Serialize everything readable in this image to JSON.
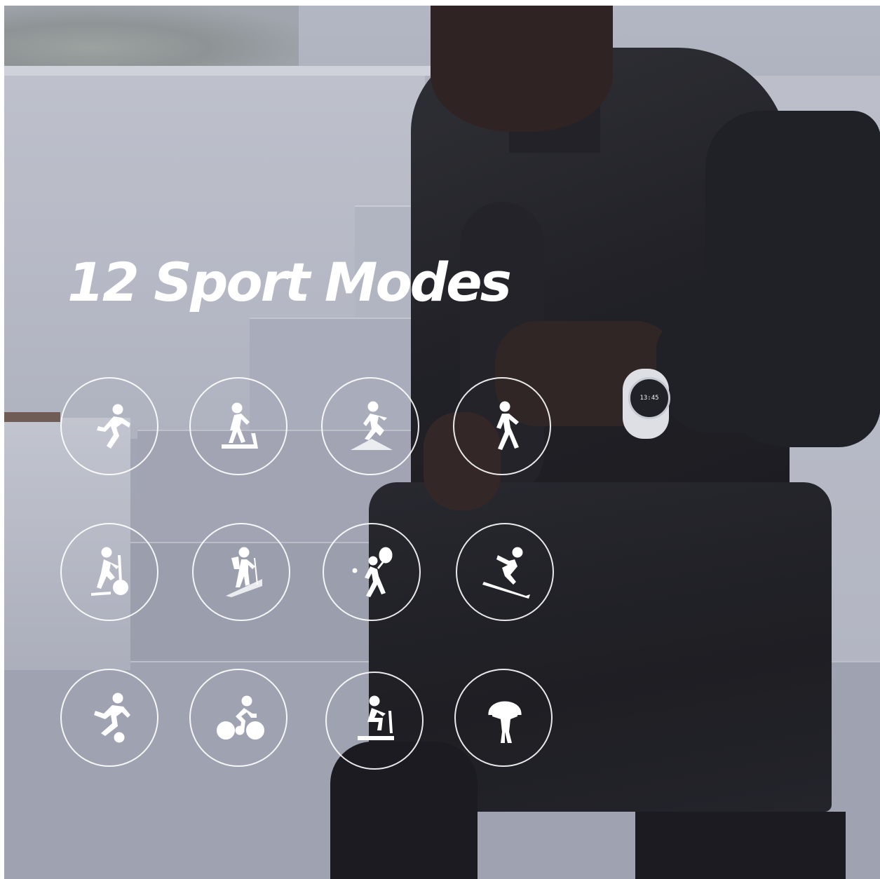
{
  "headline": "12 Sport Modes",
  "watch": {
    "time": "13:45"
  },
  "sport_modes": [
    {
      "icon": "outdoor-running-icon"
    },
    {
      "icon": "treadmill-icon"
    },
    {
      "icon": "trail-running-icon"
    },
    {
      "icon": "walking-icon"
    },
    {
      "icon": "elliptical-trainer-icon"
    },
    {
      "icon": "climbing-icon"
    },
    {
      "icon": "tennis-icon"
    },
    {
      "icon": "skiing-icon"
    },
    {
      "icon": "soccer-icon"
    },
    {
      "icon": "cycling-icon"
    },
    {
      "icon": "indoor-cycling-icon"
    },
    {
      "icon": "jump-rope-icon"
    }
  ],
  "colors": {
    "text": "#ffffff",
    "icon_ring": "#ffffff"
  }
}
